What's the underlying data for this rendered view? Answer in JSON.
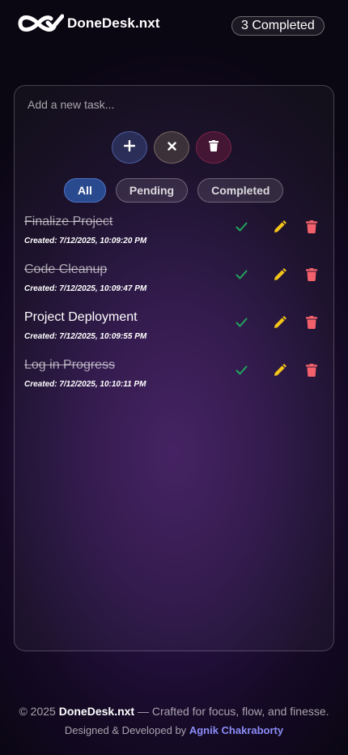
{
  "header": {
    "brand": "DoneDesk.nxt",
    "completed_badge": "3 Completed",
    "logo_icon": "infinity-check-logo-icon"
  },
  "composer": {
    "placeholder": "Add a new task...",
    "value": ""
  },
  "actions": {
    "add_icon": "plus-icon",
    "clear_icon": "x-icon",
    "delete_all_icon": "trash-icon"
  },
  "filters": [
    {
      "label": "All",
      "active": true
    },
    {
      "label": "Pending",
      "active": false
    },
    {
      "label": "Completed",
      "active": false
    }
  ],
  "tasks": [
    {
      "title": "Finalize Project",
      "created": "Created: 7/12/2025, 10:09:20 PM",
      "completed": true
    },
    {
      "title": "Code Cleanup",
      "created": "Created: 7/12/2025, 10:09:47 PM",
      "completed": true
    },
    {
      "title": "Project Deployment",
      "created": "Created: 7/12/2025, 10:09:55 PM",
      "completed": false
    },
    {
      "title": "Log in Progress",
      "created": "Created: 7/12/2025, 10:10:11 PM",
      "completed": true
    }
  ],
  "task_icons": {
    "check": "check-icon",
    "edit": "pencil-icon",
    "delete": "trash-icon"
  },
  "footer": {
    "copyright": "© 2025",
    "brand": "DoneDesk.nxt",
    "tagline": "— Crafted for focus, flow, and finesse.",
    "designed_by": "Designed & Developed by",
    "author": "Agnik Chakraborty"
  },
  "colors": {
    "check": "#22a45d",
    "edit": "#f5c518",
    "delete": "#f2616b",
    "author_link": "#8b8cf7",
    "active_filter": "#2a4a8f"
  }
}
